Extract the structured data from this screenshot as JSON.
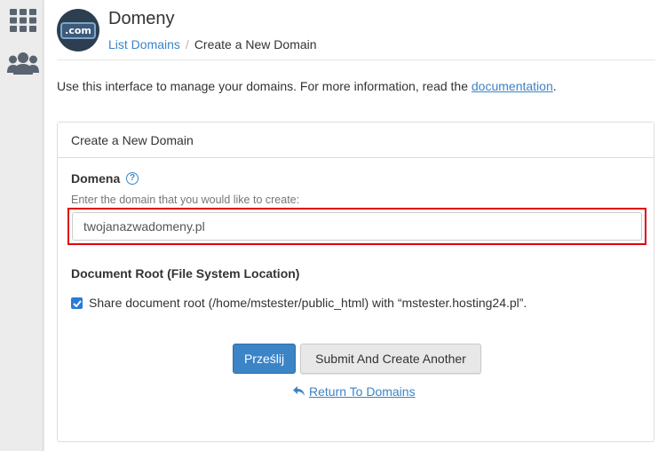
{
  "sidebar": {
    "items": [
      {
        "icon": "grid-icon"
      },
      {
        "icon": "users-icon"
      }
    ]
  },
  "header": {
    "logo_text": ".com",
    "title": "Domeny",
    "breadcrumb": {
      "parent": "List Domains",
      "separator": "/",
      "current": "Create a New Domain"
    }
  },
  "intro": {
    "text": "Use this interface to manage your domains. For more information, read the",
    "link": "documentation",
    "suffix": "."
  },
  "panel": {
    "heading": "Create a New Domain",
    "domain_label": "Domena",
    "help_glyph": "?",
    "domain_hint": "Enter the domain that you would like to create:",
    "domain_value": "twojanazwadomeny.pl",
    "docroot_label": "Document Root (File System Location)",
    "share_checked": true,
    "share_label": "Share document root (/home/mstester/public_html) with “mstester.hosting24.pl”.",
    "submit_label": "Prześlij",
    "submit_another_label": "Submit And Create Another",
    "return_label": "Return To Domains"
  },
  "colors": {
    "accent": "#3b84c6",
    "highlight": "#e0000f",
    "sidebar_icon": "#5a6470"
  }
}
